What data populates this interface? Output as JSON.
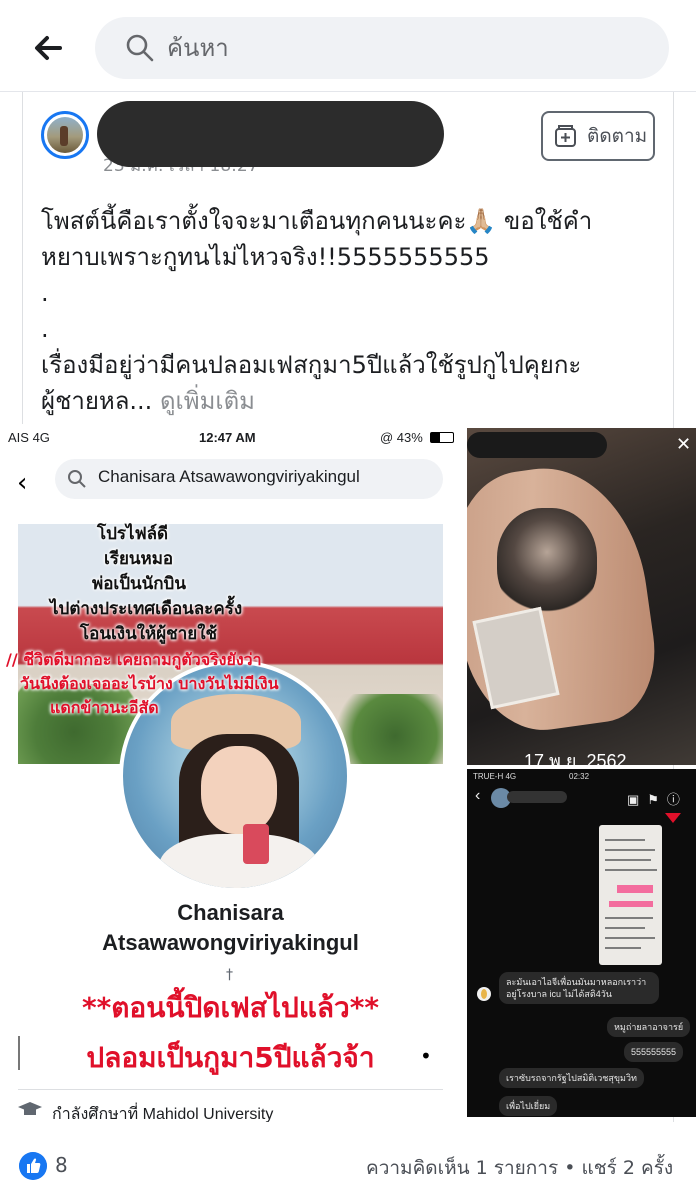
{
  "search": {
    "placeholder": "ค้นหา"
  },
  "post": {
    "timestamp_partial": "23 ม.ค. เวลา 18:27",
    "follow_label": "ติดตาม",
    "text_lines": [
      "โพสต์นี้คือเราตั้งใจจะมาเตือนทุกคนนะคะ🙏🏼 ขอใช้คำ",
      "หยาบเพราะกูทนไม่ไหวจริง!!5555555555",
      ".",
      ".",
      "เรื่องมีอยู่ว่ามีคนปลอมเฟสกูมา5ปีแล้วใช้รูปกูไปคุยกะ"
    ],
    "text_last_prefix": "ผู้ชายหล...",
    "see_more": "ดูเพิ่มเติม"
  },
  "screenshot_profile": {
    "status_carrier": "AIS  4G",
    "status_time": "12:47 AM",
    "status_battery": "@ 43%",
    "search_text": "Chanisara Atsawawongviriyakingul",
    "overlay_black": [
      "โปรไฟล์ดี",
      "เรียนหมอ",
      "พ่อเป็นนักบิน",
      "ไปต่างประเทศเดือนละครั้ง",
      "โอนเงินให้ผู้ชายใช้"
    ],
    "overlay_red": [
      "// ชีวิตดีมากอะ เคยถามกูตัวจริงยังว่า",
      "วันนึงต้องเจออะไรบ้าง บางวันไม่มีเงิน",
      "แดกข้าวนะอีสัด"
    ],
    "profile_name_1": "Chanisara",
    "profile_name_2": "Atsawawongviriyakingul",
    "red_caption_1": "**ตอนนี้ปิดเฟสไปแล้ว**",
    "red_caption_2": "ปลอมเป็นกูมา5ปีแล้วจ้า",
    "study_text": "กำลังศึกษาที่ Mahidol University"
  },
  "tattoo_photo": {
    "date": "17 พ.ย. 2562"
  },
  "chat": {
    "status_carrier": "TRUE-H  4G",
    "status_time": "02:32",
    "messages": [
      "ละมันเอาไอจีเพื่อนมันมาหลอกเราว่า อยู่โรงบาล icu ไม่ได้สติ4วัน",
      "หมูถ่ายลาอาจารย์",
      "555555555",
      "เราซับรถจากรัฐไปสมิติเวชสุขุมวิท",
      "เพื่อไปเยี่ยม"
    ]
  },
  "footer": {
    "like_count": "8",
    "stats": "ความคิดเห็น 1 รายการ • แชร์ 2 ครั้ง"
  }
}
